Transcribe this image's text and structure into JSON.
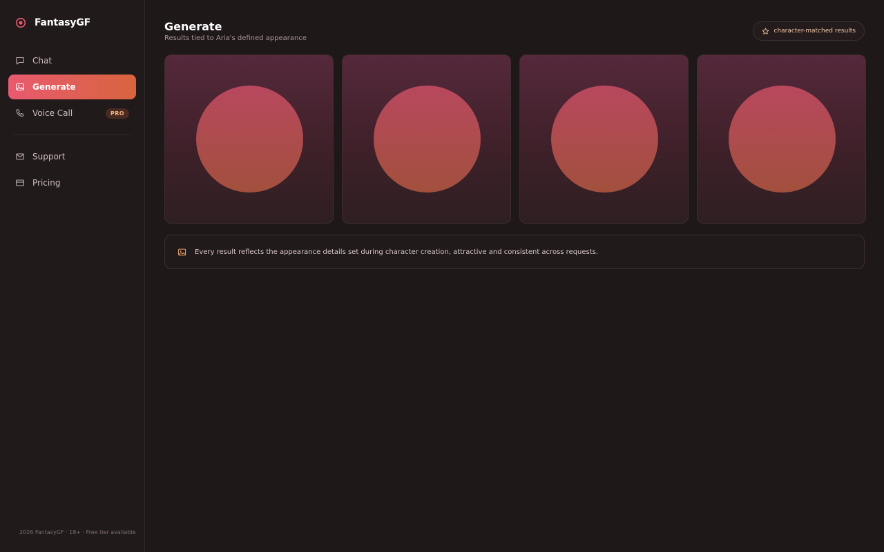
{
  "brand": {
    "name": "FantasyGF"
  },
  "sidebar": {
    "items": [
      {
        "label": "Chat",
        "icon": "chat-icon",
        "active": false
      },
      {
        "label": "Generate",
        "icon": "image-icon",
        "active": true
      },
      {
        "label": "Voice Call",
        "icon": "phone-icon",
        "active": false,
        "badge": "PRO"
      },
      {
        "label": "Support",
        "icon": "mail-icon",
        "active": false
      },
      {
        "label": "Pricing",
        "icon": "card-icon",
        "active": false
      }
    ],
    "footer": "2026 FantasyGF · 18+ · Free tier available"
  },
  "header": {
    "title": "Generate",
    "subtitle": "Results tied to Aria's defined appearance",
    "badge": "character-matched results"
  },
  "results": {
    "count_shown": 4
  },
  "info": {
    "text": "Every result reflects the appearance details set during character creation, attractive and consistent across requests."
  },
  "colors": {
    "accent_start": "#e85a6f",
    "accent_end": "#d8643e",
    "background": "#1f1819",
    "pro_badge": "#f0b27a"
  }
}
